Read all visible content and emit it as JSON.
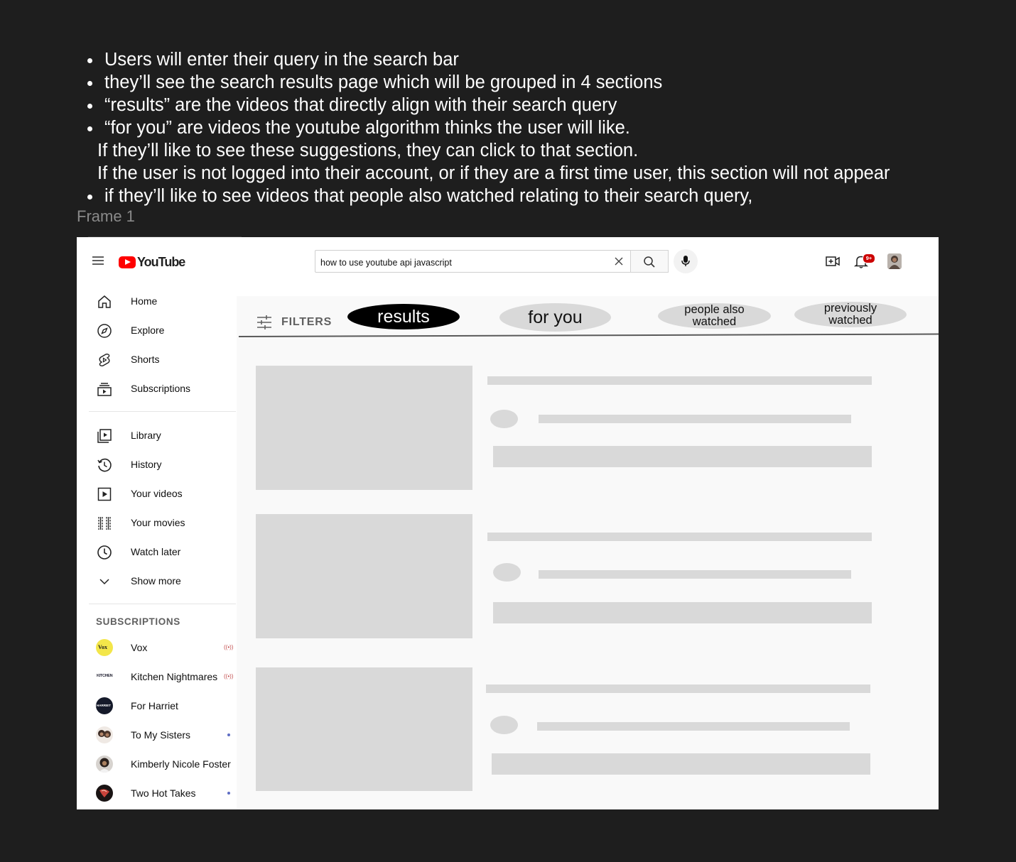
{
  "notes": {
    "bullet1": "Users will enter their query in the search bar",
    "bullet2": "they’ll see the search results page which will be grouped in 4 sections",
    "bullet3": "“results” are the videos that directly align with their search query",
    "bullet4": "“for you” are videos the youtube algorithm thinks the user will like.",
    "bullet4_line2": "If they’ll like to see these suggestions, they can click to that section.",
    "bullet4_line3": "If the user is not logged into their account, or if they are a first time user, this section will not appear",
    "bullet5": "if they’ll like to see videos that people also watched relating to their search query,"
  },
  "frame_label": "Frame 1",
  "header": {
    "logo_text": "YouTube",
    "search_value": "how to use youtube api javascript",
    "notification_badge": "9+",
    "icons": [
      "menu-icon",
      "search-icon",
      "clear-icon",
      "mic-icon",
      "create-video-icon",
      "bell-icon"
    ]
  },
  "sidebar": {
    "main_items": [
      {
        "label": "Home",
        "icon": "home-icon"
      },
      {
        "label": "Explore",
        "icon": "compass-icon"
      },
      {
        "label": "Shorts",
        "icon": "shorts-icon"
      },
      {
        "label": "Subscriptions",
        "icon": "subscriptions-icon"
      }
    ],
    "library_items": [
      {
        "label": "Library",
        "icon": "library-icon"
      },
      {
        "label": "History",
        "icon": "history-icon"
      },
      {
        "label": "Your videos",
        "icon": "your-videos-icon"
      },
      {
        "label": "Your movies",
        "icon": "movies-icon"
      },
      {
        "label": "Watch later",
        "icon": "clock-icon"
      },
      {
        "label": "Show more",
        "icon": "chevron-down-icon"
      }
    ],
    "subscriptions_heading": "SUBSCRIPTIONS",
    "subscriptions": [
      {
        "name": "Vox",
        "avatar_text": "Vox",
        "status": "live"
      },
      {
        "name": "Kitchen Nightmares",
        "avatar_text": "KITCHEN",
        "status": "live"
      },
      {
        "name": "For Harriet",
        "avatar_text": "HARRIET",
        "status": ""
      },
      {
        "name": "To My Sisters",
        "avatar_text": "",
        "status": "new"
      },
      {
        "name": "Kimberly Nicole Foster",
        "avatar_text": "",
        "status": ""
      },
      {
        "name": "Two Hot Takes",
        "avatar_text": "",
        "status": "new"
      }
    ]
  },
  "main": {
    "filters_label": "FILTERS",
    "tabs": [
      {
        "label": "results",
        "selected": true
      },
      {
        "label": "for you",
        "selected": false
      },
      {
        "label": "people also watched",
        "selected": false
      },
      {
        "label": "previously watched",
        "selected": false
      }
    ],
    "result_placeholder_count": 3
  },
  "colors": {
    "canvas_background": "#1e1e1e",
    "placeholder": "#d9d9d9",
    "selected_tab": "#000000",
    "brand_red": "#ff0000"
  }
}
